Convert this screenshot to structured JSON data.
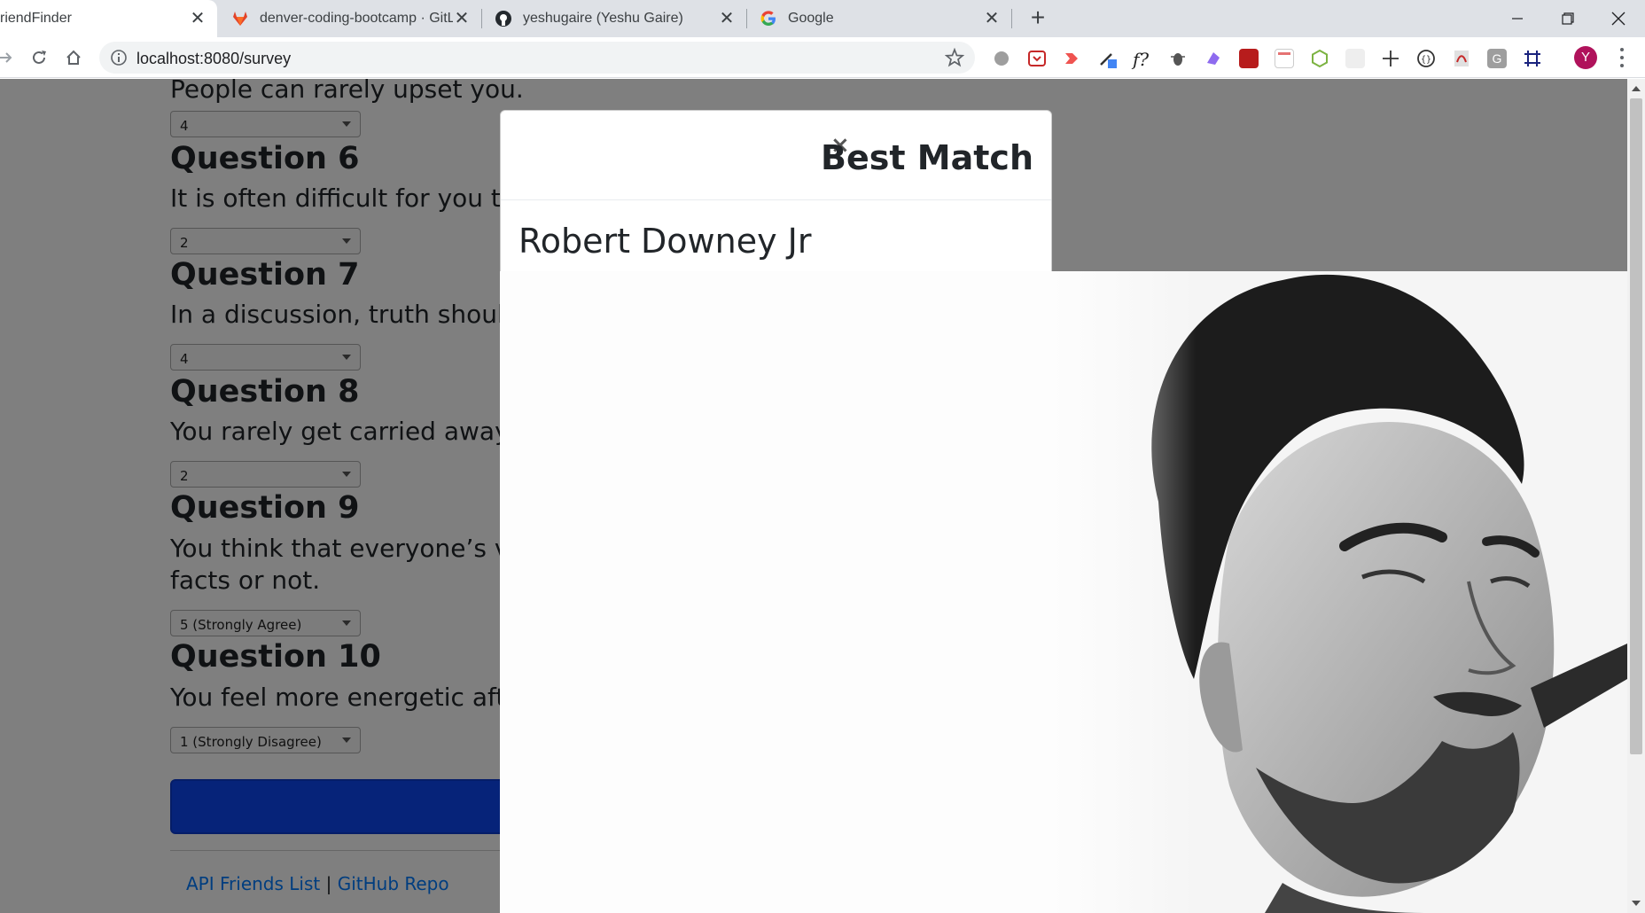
{
  "browser": {
    "tabs": [
      {
        "title": "riendFinder",
        "active": true,
        "icon": "page-icon"
      },
      {
        "title": "denver-coding-bootcamp · GitLab",
        "active": false,
        "icon": "gitlab-icon"
      },
      {
        "title": "yeshugaire (Yeshu Gaire)",
        "active": false,
        "icon": "github-icon"
      },
      {
        "title": "Google",
        "active": false,
        "icon": "google-icon"
      }
    ],
    "new_tab_label": "+",
    "address": "localhost:8080/survey",
    "profile_initial": "Y",
    "profile_color": "#b0125b"
  },
  "survey": {
    "q5_text": "People can rarely upset you.",
    "q5_answer": "4",
    "questions": [
      {
        "heading": "Question 6",
        "text": "It is often difficult for you to",
        "answer": "2"
      },
      {
        "heading": "Question 7",
        "text": "In a discussion, truth should",
        "answer": "4"
      },
      {
        "heading": "Question 8",
        "text": "You rarely get carried away",
        "answer": "2"
      },
      {
        "heading": "Question 9",
        "text": "You think that everyone’s vi",
        "text2": "facts or not.",
        "answer": "5 (Strongly Agree)"
      },
      {
        "heading": "Question 10",
        "text": "You feel more energetic afte",
        "answer": "1 (Strongly Disagree)"
      }
    ],
    "submit_color": "#0d47f2"
  },
  "footer": {
    "api_link": "API Friends List",
    "separator": "|",
    "repo_link": "GitHub Repo"
  },
  "modal": {
    "close_symbol": "×",
    "title": "Best Match",
    "match_name": "Robert Downey Jr",
    "photo_icon": "portrait-photo"
  }
}
